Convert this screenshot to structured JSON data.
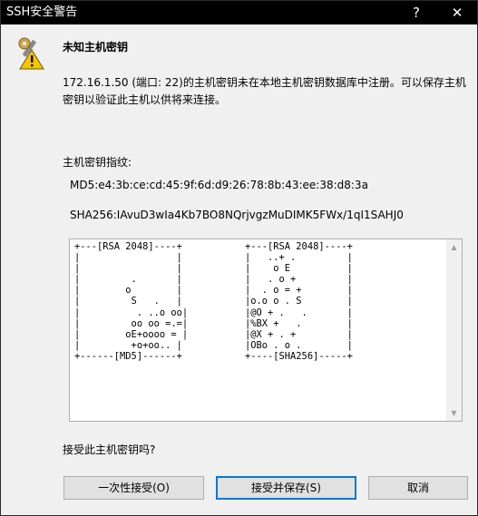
{
  "window": {
    "title": "SSH安全警告",
    "help_label": "?",
    "close_label": "✕"
  },
  "dialog": {
    "heading": "未知主机密钥",
    "message": "172.16.1.50 (端口: 22)的主机密钥未在本地主机密钥数据库中注册。可以保存主机密钥以验证此主机以供将来连接。",
    "fingerprint_label": "主机密钥指纹:",
    "md5": "MD5:e4:3b:ce:cd:45:9f:6d:d9:26:78:8b:43:ee:38:d8:3a",
    "sha256": "SHA256:IAvuD3wIa4Kb7BO8NQrjvgzMuDIMK5FWx/1qI1SAHJ0",
    "randomart_md5": "+---[RSA 2048]----+\n|                 |\n|                 |\n|         .       |\n|        o        |\n|         S   .   |\n|          . ..o oo|\n|         oo oo =.=|\n|        oE+oooo = |\n|         +o+oo.. |\n+------[MD5]------+",
    "randomart_sha256": "+---[RSA 2048]----+\n|   ..+ .         |\n|    o E          |\n|   . o +         |\n|  . o = +        |\n|o.o o . S        |\n|@O + .   .       |\n|%BX +   .        |\n|@X + . +         |\n|OBo . o .        |\n+----[SHA256]-----+",
    "question": "接受此主机密钥吗?"
  },
  "buttons": {
    "accept_once": "一次性接受(O)",
    "accept_save": "接受并保存(S)",
    "cancel": "取消"
  },
  "icons": {
    "warning": "key-warning-icon",
    "scroll_up": "chevron-up-icon",
    "scroll_down": "chevron-down-icon"
  },
  "colors": {
    "titlebar": "#000000",
    "default_button_border": "#0078d7",
    "warning_yellow": "#f7c600"
  }
}
